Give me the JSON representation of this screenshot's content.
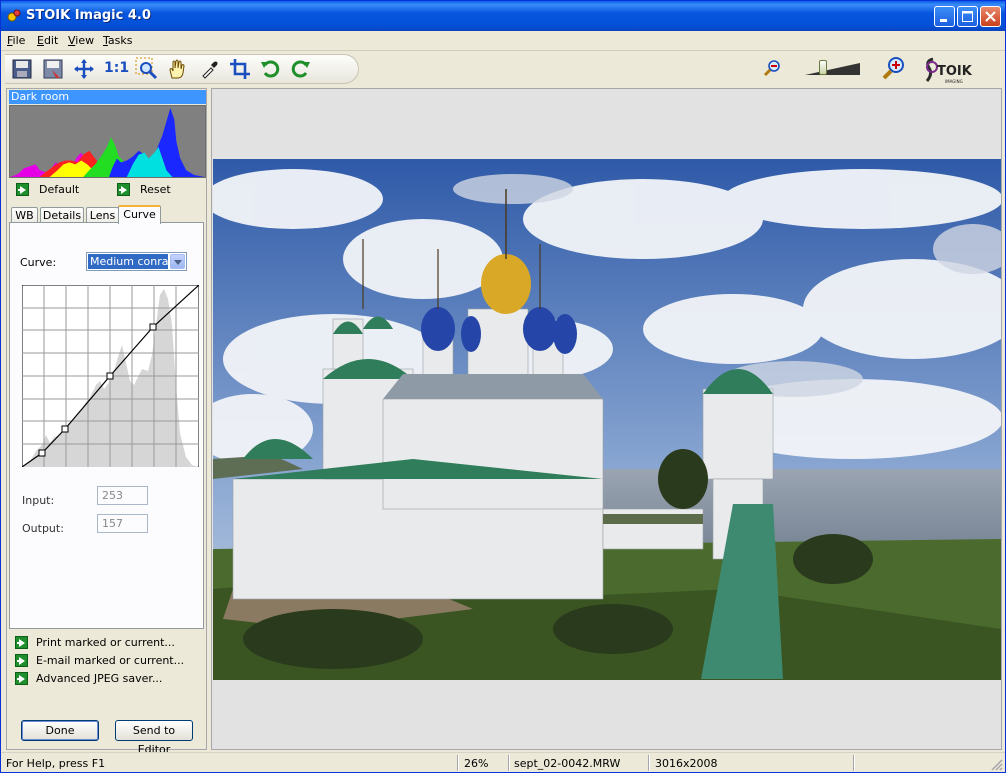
{
  "window": {
    "title": "STOIK Imagic 4.0"
  },
  "menu": [
    {
      "key": "F",
      "rest": "ile"
    },
    {
      "key": "E",
      "rest": "dit"
    },
    {
      "key": "V",
      "rest": "iew"
    },
    {
      "key": "T",
      "rest": "asks"
    }
  ],
  "toolbar": {
    "one_to_one": "1:1",
    "icons": [
      "save-icon",
      "save-as-icon",
      "fit-icon",
      "actual-size-icon",
      "zoom-rect-icon",
      "hand-icon",
      "eyedropper-icon",
      "crop-icon",
      "rotate-left-icon",
      "rotate-right-icon"
    ],
    "zoom_level": 0.26
  },
  "panel": {
    "title": "Dark room",
    "default_label": "Default",
    "reset_label": "Reset",
    "tabs": [
      "WB",
      "Details",
      "Lens",
      "Curve"
    ],
    "active_tab": "Curve",
    "curve_label": "Curve:",
    "curve_value": "Medium conrast",
    "input_label": "Input:",
    "input_value": "253",
    "output_label": "Output:",
    "output_value": "157",
    "links": [
      "Print marked or current...",
      "E-mail marked or current...",
      "Advanced JPEG saver..."
    ],
    "done_label": "Done",
    "send_label": "Send to Editor"
  },
  "status": {
    "help": "For Help, press F1",
    "zoom": "26%",
    "filename": "sept_02-0042.MRW",
    "dimensions": "3016x2008"
  },
  "colors": {
    "accent": "#316ac5",
    "titlebar": "#0853e0",
    "panel_title": "#3d95ff"
  }
}
